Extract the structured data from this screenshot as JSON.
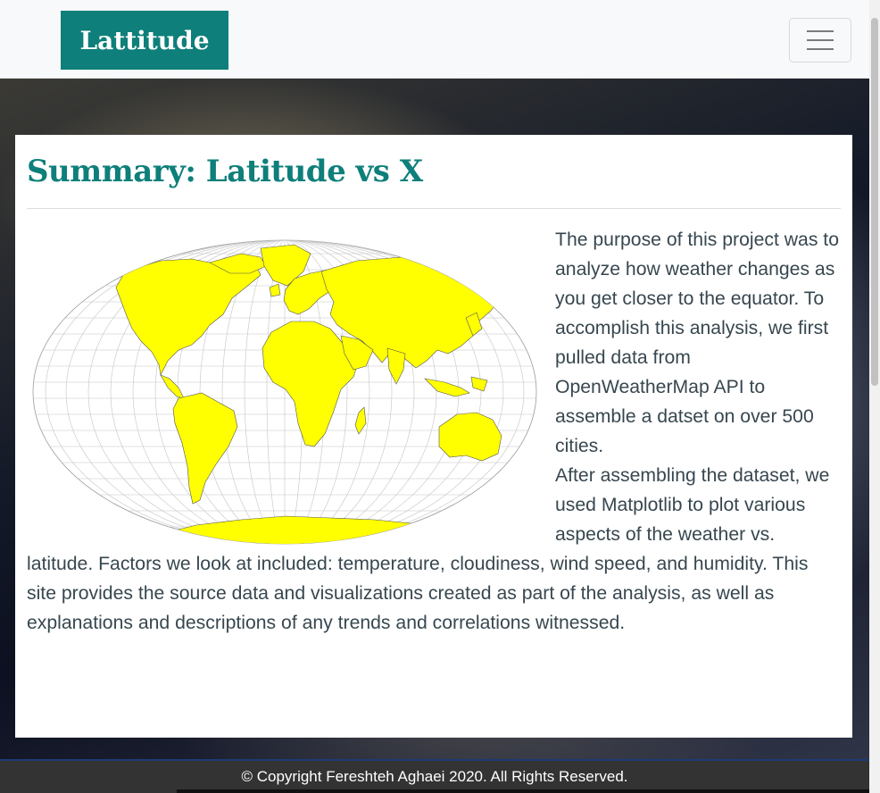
{
  "header": {
    "brand": "Lattitude",
    "menu_icon": "hamburger-menu-icon"
  },
  "main": {
    "title": "Summary: Latitude vs X",
    "map_image": {
      "icon": "world-map-image",
      "land_color": "#ffff00"
    },
    "paragraph_1": "The purpose of this project was to analyze how weather changes as you get closer to the equator. To accomplish this analysis, we first pulled data from OpenWeatherMap API to assemble a datset on over 500 cities.",
    "paragraph_2": "After assembling the dataset, we used Matplotlib to plot various aspects of the weather vs. latitude. Factors we look at included: temperature, cloudiness, wind speed, and humidity. This site provides the source data and visualizations created as part of the analysis, as well as explanations and descriptions of any trends and correlations witnessed."
  },
  "footer": {
    "copyright": "© Copyright Fereshteh Aghaei 2020. All Rights Reserved."
  },
  "colors": {
    "brand": "#0e7f7a",
    "text": "#37474f",
    "footer_bg": "#333333"
  }
}
